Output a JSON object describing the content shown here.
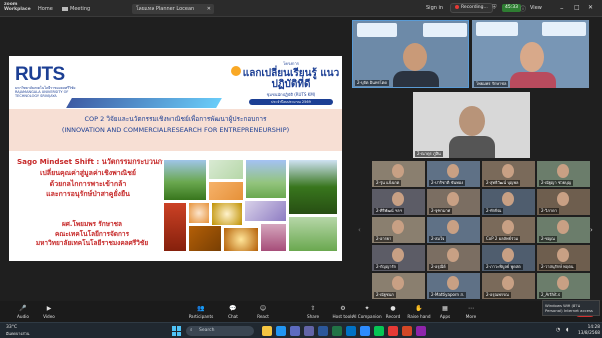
{
  "app": {
    "logo_line1": "zoom",
    "logo_line2": "Workplace"
  },
  "tabs": [
    {
      "label": "Home"
    },
    {
      "label": "Meeting"
    },
    {
      "label": "โลยแทล Planner Locean"
    }
  ],
  "top_right": {
    "sign_in": "Sign in",
    "recording": "Recording...",
    "badge": "45:33",
    "view": "View"
  },
  "slide": {
    "logo": "RUTS",
    "logo_sub": "มหาวิทยาลัยเทคโนโลยีราชมงคลศรีวิชัย RAJAMANGALA UNIVERSITY OF TECHNOLOGY SRIVIJAYA",
    "banner_small": "โครงการ",
    "banner_big": "แลกเปลี่ยนเรียนรู้ แนวปฏิบัติที่ดี",
    "banner_sub": "ชุมชนนักปฏิบัติ (RUTS KM)",
    "banner_date": "ประจำปีงบประมาณ 2569",
    "cop_line1": "COP 2 วิจัยและนวัตกรรมเชิงพาณิชย์เพื่อการพัฒนาผู้ประกอบการ",
    "cop_line2": "(INNOVATION AND COMMERCIALRESEARCH FOR ENTREPRENEURSHIP)",
    "sago_title": "Sago Mindset Shift : นวัตกรรมกระบวนการ",
    "sago_lines": [
      "เปลี่ยนคุณค่าสู่มูลค่าเชิงพาณิชย์",
      "ด้วยกลไกการพาะเข้ากล้า",
      "และการอนุรักษ์ป่าสาคูยั่งยืน"
    ],
    "uni_lines": [
      "ผศ.โพยมพร รักษาชล",
      "คณะเทคโนโลยีการจัดการ",
      "มหาวิทยาลัยเทคโนโลยีราชมงคลศรีวิชัย"
    ]
  },
  "speakers": [
    {
      "name": "2-บุจัต อินทรโตด"
    },
    {
      "name": "โพยมพร รักษาชล"
    }
  ],
  "self_view": {
    "name": "2-ณาดุร ภู่สิน"
  },
  "gallery": [
    "2-รุ่น แจ้งเกต",
    "2-ปาริชาติ ขันทอง",
    "2-สุทธิวัฒน์ บุญพล",
    "2-ณัฐญา ช่วยบุญ",
    "2-ศิริพัฒน์ ฯลฯ",
    "2-จุฑามาศ",
    "2-ทักษิณ",
    "2-วิภาดา",
    "2-อารยา",
    "2-สมใจ",
    "CoP 2 ผลลัพธ์ร่วม",
    "2-ชญณ",
    "2-กัญญารัก",
    "2-อรุณีย์",
    "2-ภาวะพิบูลย์ พูดสต",
    "2-วาสนุรักษ์ พฤตน",
    "2-ณัฐชนก",
    "2-Mattiyaporn ส.",
    "2-อรุณพรรณ",
    "2_Arthit.s"
  ],
  "gallery_pager": "1/2",
  "controls": [
    {
      "label": "Audio"
    },
    {
      "label": "Video"
    },
    {
      "label": "Participants"
    },
    {
      "label": "Chat"
    },
    {
      "label": "React"
    },
    {
      "label": "Share"
    },
    {
      "label": "Host tools"
    },
    {
      "label": "AI Companion"
    },
    {
      "label": "Record"
    },
    {
      "label": "Raise hand"
    },
    {
      "label": "Apps"
    },
    {
      "label": "More"
    },
    {
      "label": "End"
    }
  ],
  "taskbar": {
    "weather_temp": "33°C",
    "weather_desc": "มีแดดบางส่วน",
    "search": "Search",
    "time": "14:28",
    "date": "13/8/2568"
  },
  "toast": {
    "text": "Windows Wifi (ผ่าน Personal) Internet access"
  },
  "colors": {
    "brand_blue": "#1c3f94",
    "accent_red": "#c62828",
    "zoom_bg": "#1f1f1f",
    "slide_band": "#f7dfd4"
  }
}
